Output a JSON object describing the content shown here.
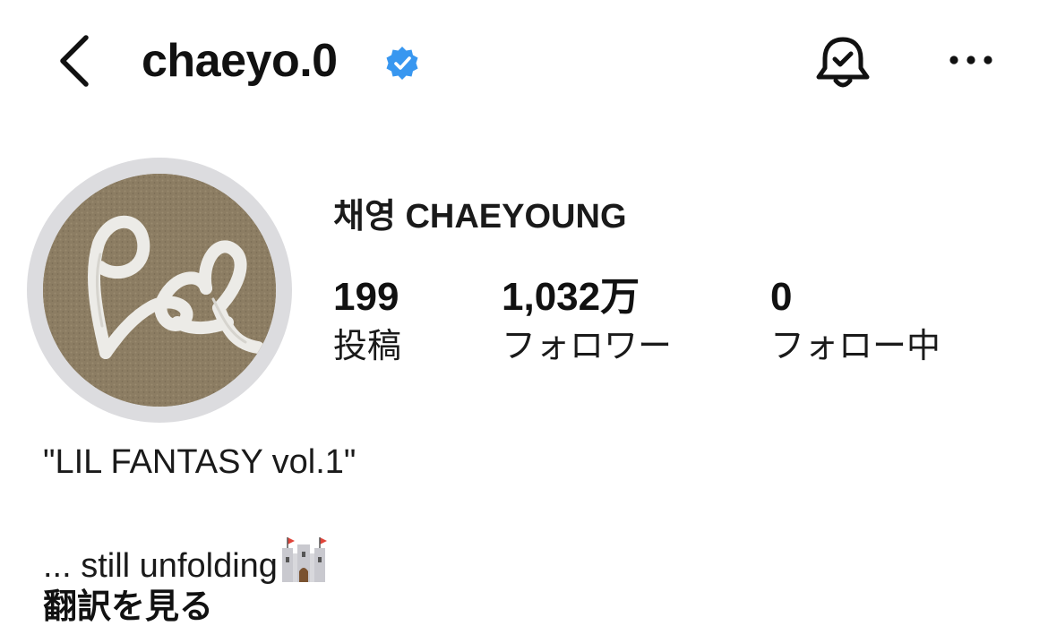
{
  "header": {
    "username": "chaeyo.0",
    "verified": true,
    "icons": {
      "back": "chevron-left-icon",
      "verified": "verified-badge-icon",
      "notifications": "bell-check-icon",
      "more": "more-horizontal-icon"
    },
    "colors": {
      "verified_badge": "#3897f0"
    }
  },
  "profile": {
    "display_name": "채영 CHAEYOUNG",
    "stats": {
      "posts": {
        "value": "199",
        "label": "投稿"
      },
      "followers": {
        "value": "1,032万",
        "label": "フォロワー"
      },
      "following": {
        "value": "0",
        "label": "フォロー中"
      }
    },
    "bio": {
      "line1": "\"LIL FANTASY vol.1\"",
      "line2": "... still unfolding",
      "line2_emoji": "castle-icon"
    },
    "translate_label": "翻訳を見る"
  }
}
